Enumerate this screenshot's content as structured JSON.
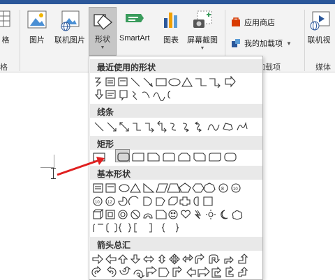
{
  "ribbon": {
    "table_label": "格",
    "picture_label": "图片",
    "online_picture_label": "联机图片",
    "shapes_label": "形状",
    "smartart_label": "SmartArt",
    "chart_label": "图表",
    "screenshot_label": "屏幕截图",
    "store_label": "应用商店",
    "my_addins_label": "我的加载项",
    "online_video_label": "联机视",
    "table_group": "格",
    "addins_group": "加载项",
    "media_group": "媒体"
  },
  "dropdown": {
    "recent_header": "最近使用的形状",
    "lines_header": "线条",
    "rect_header": "矩形",
    "basic_header": "基本形状",
    "arrows_header": "箭头总汇"
  },
  "colors": {
    "ribbon_blue": "#2b579a",
    "store_icon": "#d83b01",
    "addin_icon": "#2b579a",
    "arrow_red": "#e02020"
  }
}
